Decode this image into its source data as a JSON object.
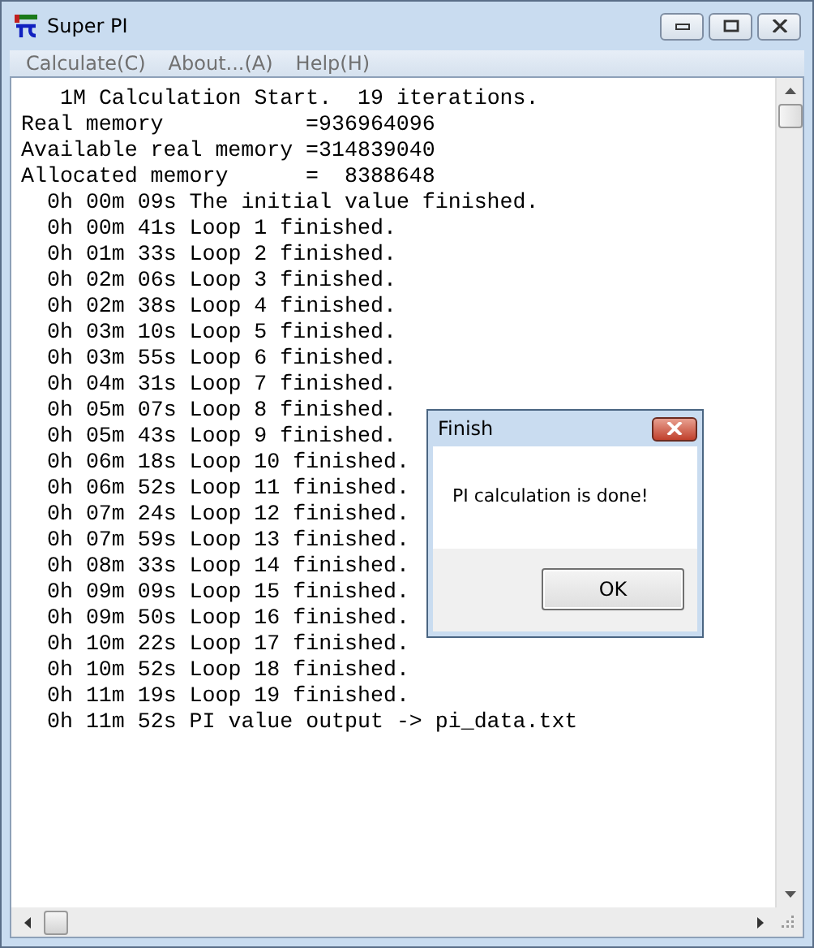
{
  "window": {
    "title": "Super PI"
  },
  "menu": [
    "Calculate(C)",
    "About...(A)",
    "Help(H)"
  ],
  "output": [
    {
      "kind": "header",
      "text": "1M Calculation Start.  19 iterations."
    },
    {
      "kind": "info",
      "text": "Real memory           =936964096"
    },
    {
      "kind": "info",
      "text": "Available real memory =314839040"
    },
    {
      "kind": "info",
      "text": "Allocated memory      =  8388648"
    },
    {
      "kind": "log",
      "text": "0h 00m 09s The initial value finished."
    },
    {
      "kind": "log",
      "text": "0h 00m 41s Loop 1 finished."
    },
    {
      "kind": "log",
      "text": "0h 01m 33s Loop 2 finished."
    },
    {
      "kind": "log",
      "text": "0h 02m 06s Loop 3 finished."
    },
    {
      "kind": "log",
      "text": "0h 02m 38s Loop 4 finished."
    },
    {
      "kind": "log",
      "text": "0h 03m 10s Loop 5 finished."
    },
    {
      "kind": "log",
      "text": "0h 03m 55s Loop 6 finished."
    },
    {
      "kind": "log",
      "text": "0h 04m 31s Loop 7 finished."
    },
    {
      "kind": "log",
      "text": "0h 05m 07s Loop 8 finished."
    },
    {
      "kind": "log",
      "text": "0h 05m 43s Loop 9 finished."
    },
    {
      "kind": "log",
      "text": "0h 06m 18s Loop 10 finished."
    },
    {
      "kind": "log",
      "text": "0h 06m 52s Loop 11 finished."
    },
    {
      "kind": "log",
      "text": "0h 07m 24s Loop 12 finished."
    },
    {
      "kind": "log",
      "text": "0h 07m 59s Loop 13 finished."
    },
    {
      "kind": "log",
      "text": "0h 08m 33s Loop 14 finished."
    },
    {
      "kind": "log",
      "text": "0h 09m 09s Loop 15 finished."
    },
    {
      "kind": "log",
      "text": "0h 09m 50s Loop 16 finished."
    },
    {
      "kind": "log",
      "text": "0h 10m 22s Loop 17 finished."
    },
    {
      "kind": "log",
      "text": "0h 10m 52s Loop 18 finished."
    },
    {
      "kind": "log",
      "text": "0h 11m 19s Loop 19 finished."
    },
    {
      "kind": "log",
      "text": "0h 11m 52s PI value output -> pi_data.txt"
    }
  ],
  "dialog": {
    "title": "Finish",
    "message": "PI calculation is done!",
    "button": "OK"
  }
}
